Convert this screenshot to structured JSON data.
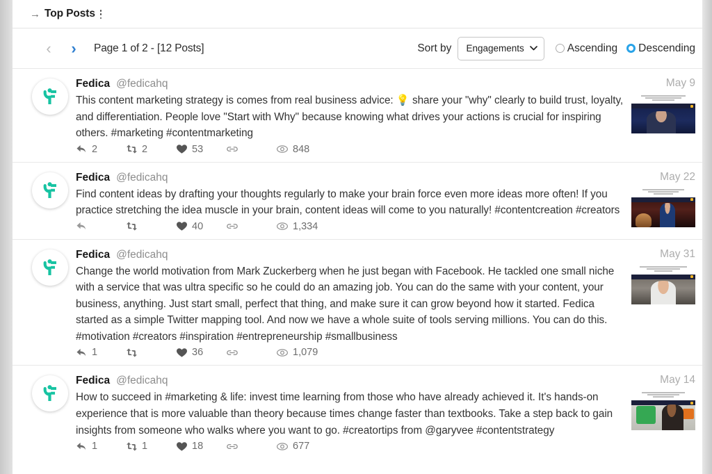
{
  "header": {
    "back_arrow": "→",
    "title": "Top Posts",
    "menu_icon": "kebab-menu-icon"
  },
  "toolbar": {
    "prev_label": "‹",
    "next_label": "›",
    "page_label": "Page 1 of 2 - [12 Posts]",
    "sort_by_label": "Sort by",
    "sort_value": "Engagements",
    "sort_options": [
      "Engagements"
    ],
    "caret": "⌄",
    "order_options": [
      {
        "label": "Ascending",
        "selected": false
      },
      {
        "label": "Descending",
        "selected": true
      }
    ],
    "accent_color": "#29a3e8"
  },
  "posts": [
    {
      "author": "Fedica",
      "handle": "@fedicahq",
      "date": "May 9",
      "text": "This content marketing strategy is comes from real business advice: 💡 share your \"why\" clearly to build trust, loyalty, and differentiation. People love \"Start with Why\" because knowing what drives your actions is crucial for inspiring others. #marketing #contentmarketing",
      "metrics": {
        "replies": "2",
        "retweets": "2",
        "likes": "53",
        "links": "",
        "views": "848"
      },
      "thumbnail": "video-thumbnail-dark-blue"
    },
    {
      "author": "Fedica",
      "handle": "@fedicahq",
      "date": "May 22",
      "text": "Find content ideas by drafting your thoughts regularly to make your brain force even more ideas more often! If you practice stretching the idea muscle in your brain, content ideas will come to you naturally! #contentcreation #creators",
      "metrics": {
        "replies": "",
        "retweets": "",
        "likes": "40",
        "links": "",
        "views": "1,334"
      },
      "thumbnail": "video-thumbnail-stage-red"
    },
    {
      "author": "Fedica",
      "handle": "@fedicahq",
      "date": "May 31",
      "text": "Change the world motivation from Mark Zuckerberg when he just began with Facebook. He tackled one small niche with a service that was ultra specific so he could do an amazing job. You can do the same with your content, your business, anything. Just start small, perfect that thing, and make sure it can grow beyond how it started. Fedica started as a simple Twitter mapping tool. And now we have a whole suite of tools serving millions. You can do this. #motivation #creators #inspiration #entrepreneurship #smallbusiness",
      "metrics": {
        "replies": "1",
        "retweets": "",
        "likes": "36",
        "links": "",
        "views": "1,079"
      },
      "thumbnail": "video-thumbnail-gray-interview"
    },
    {
      "author": "Fedica",
      "handle": "@fedicahq",
      "date": "May 14",
      "text": "How to succeed in #marketing & life: invest time learning from those who have already achieved it. It's hands-on experience that is more valuable than theory because times change faster than textbooks. Take a step back to gain insights from someone who walks where you want to go. #creatortips from @garyvee #contentstrategy",
      "metrics": {
        "replies": "1",
        "retweets": "1",
        "likes": "18",
        "links": "",
        "views": "677"
      },
      "thumbnail": "video-thumbnail-green-music"
    }
  ]
}
